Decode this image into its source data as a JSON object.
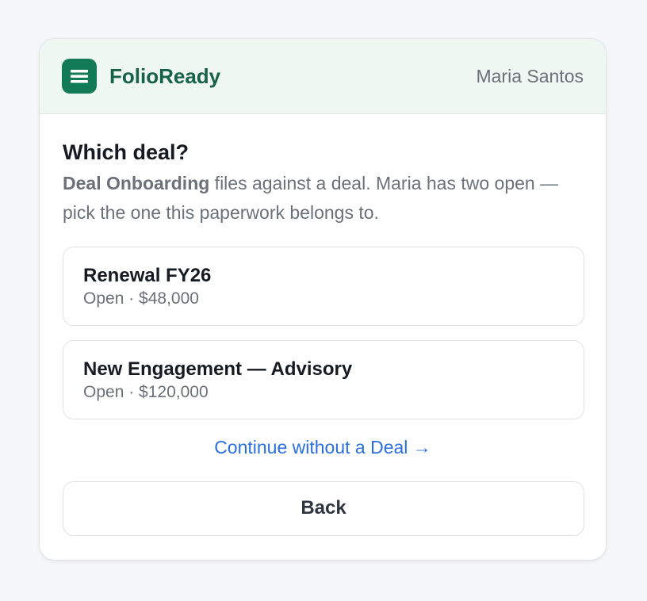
{
  "header": {
    "logo_icon": "menu-lines-icon",
    "brand": "FolioReady",
    "user_name": "Maria Santos"
  },
  "main": {
    "title": "Which deal?",
    "description_strong": "Deal Onboarding",
    "description_rest": " files against a deal. Maria has two open — pick the one this paperwork belongs to.",
    "deals": [
      {
        "name": "Renewal FY26",
        "meta": "Open · $48,000"
      },
      {
        "name": "New Engagement — Advisory",
        "meta": "Open · $120,000"
      }
    ],
    "continue_label": "Continue without a Deal →",
    "back_label": "Back"
  },
  "colors": {
    "brand": "#137a57",
    "brand_text": "#17604a",
    "header_bg": "#eef7f1",
    "link": "#2a6fe0",
    "page_bg": "#f6f7f9"
  }
}
